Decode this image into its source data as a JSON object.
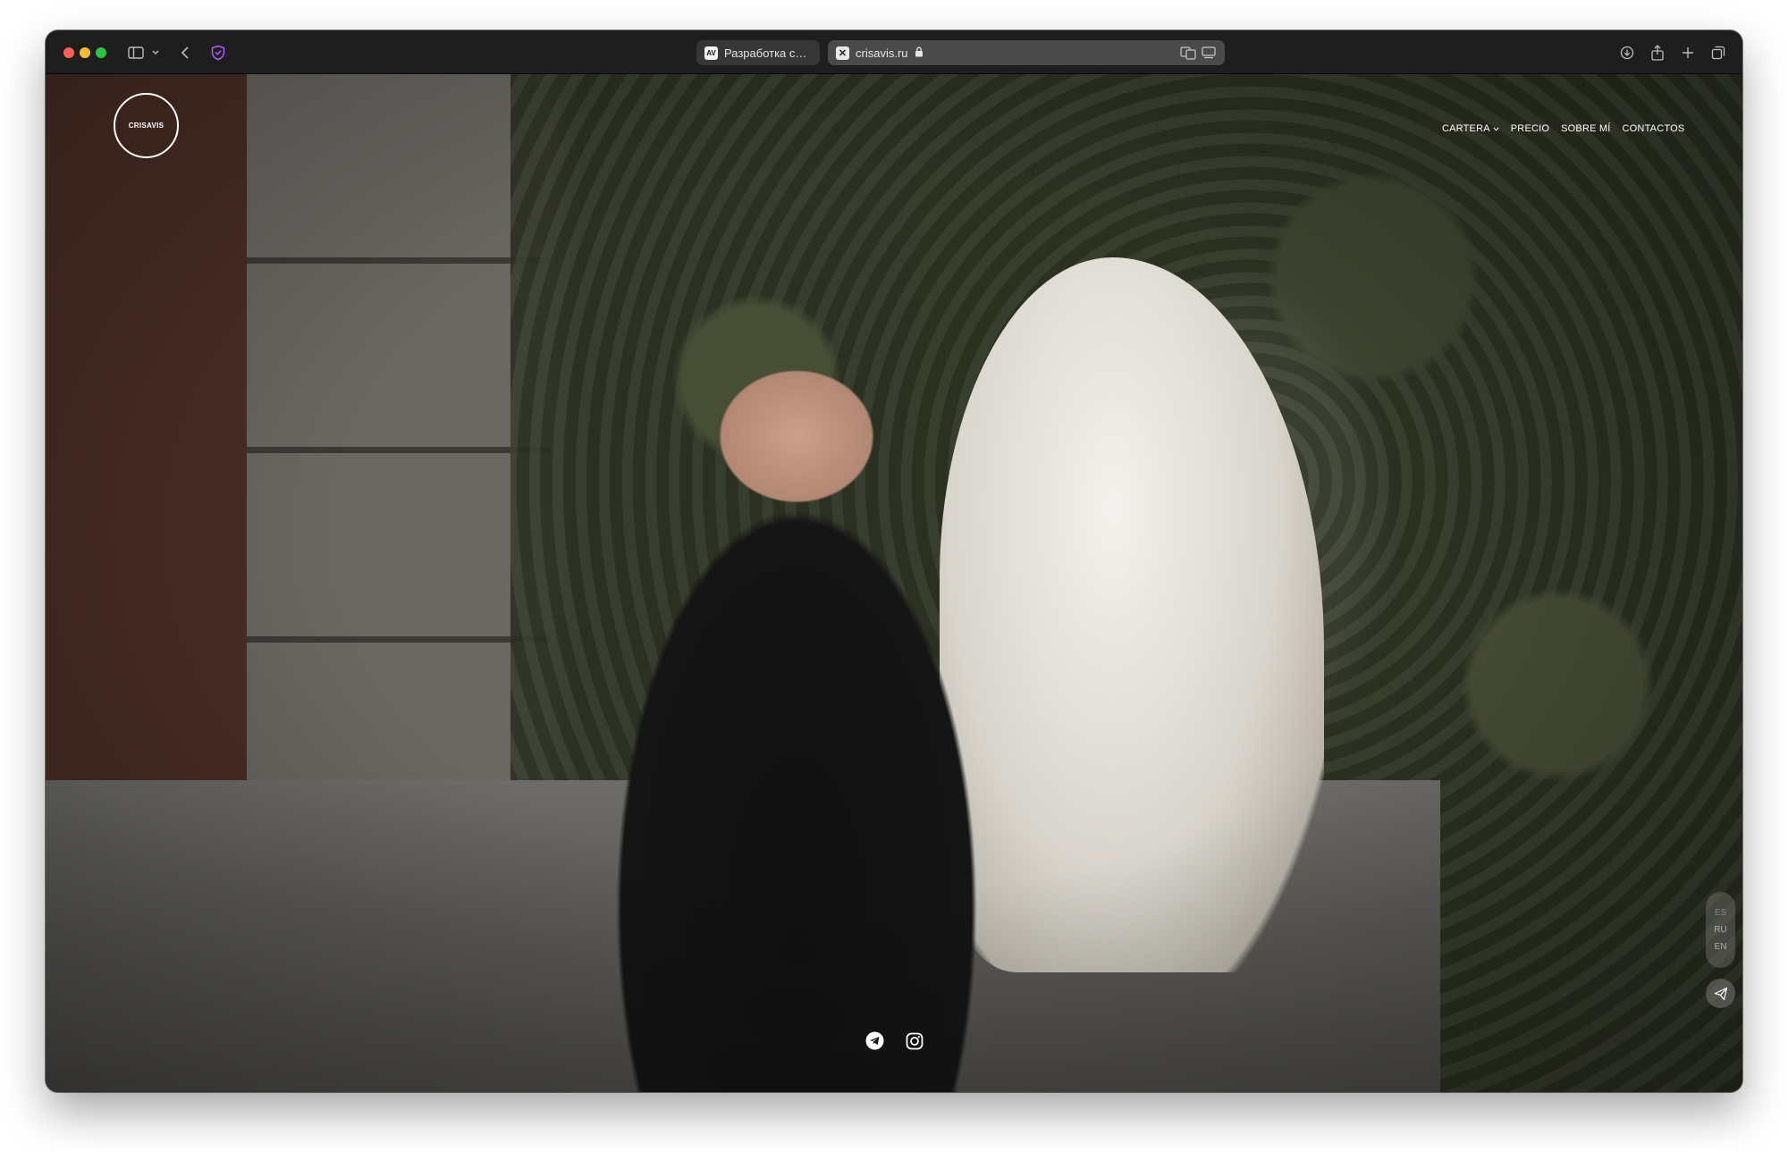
{
  "browser": {
    "tabs": [
      {
        "favicon": "AV",
        "title": "Разработка сай...",
        "active": false
      },
      {
        "favicon": "✕",
        "title": "crisavis.ru",
        "active": true
      }
    ],
    "icons": [
      "sidebar-icon",
      "chevron-down-icon",
      "back-icon",
      "shield-icon",
      "translate-icon",
      "reader-icon",
      "download-icon",
      "share-icon",
      "new-tab-icon",
      "tab-overview-icon"
    ]
  },
  "site": {
    "logo": "CRISAVIS",
    "nav": [
      {
        "label": "CARTERA",
        "has_dropdown": true
      },
      {
        "label": "PRECIO",
        "has_dropdown": false
      },
      {
        "label": "SOBRE MÍ",
        "has_dropdown": false
      },
      {
        "label": "CONTACTOS",
        "has_dropdown": false
      }
    ],
    "languages": [
      "ES",
      "RU",
      "EN"
    ],
    "socials": [
      "telegram-icon",
      "instagram-icon"
    ]
  },
  "colors": {
    "traffic_red": "#ff5f57",
    "traffic_yellow": "#febc2e",
    "traffic_green": "#28c840",
    "toolbar": "#1e1e1e"
  }
}
